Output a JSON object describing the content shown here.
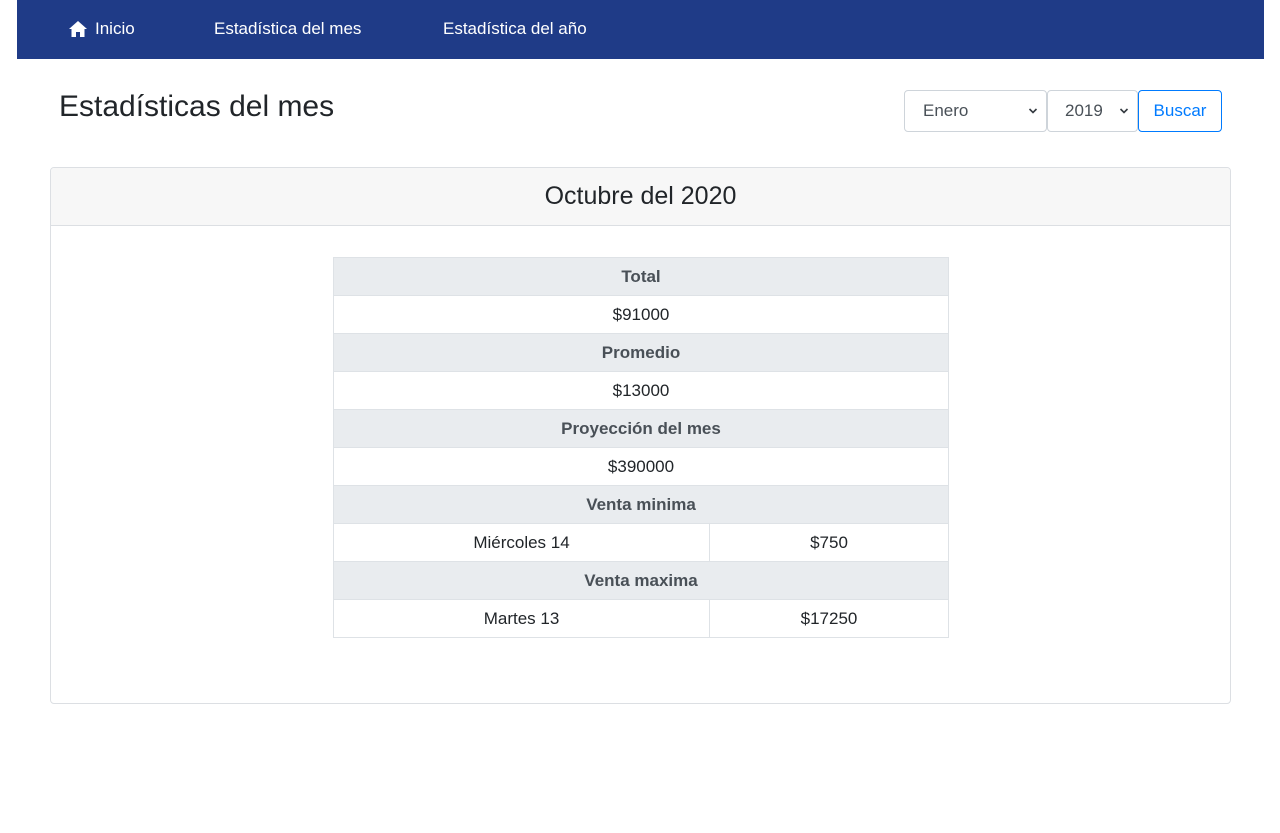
{
  "nav": {
    "home_label": "Inicio",
    "month_stats_label": "Estadística del mes",
    "year_stats_label": "Estadística del año",
    "home_icon": "home-icon"
  },
  "page": {
    "title": "Estadísticas del mes"
  },
  "filter": {
    "month_selected": "Enero",
    "year_selected": "2019",
    "search_label": "Buscar"
  },
  "card": {
    "title": "Octubre del 2020"
  },
  "stats": {
    "total_label": "Total",
    "total_value": "$91000",
    "average_label": "Promedio",
    "average_value": "$13000",
    "projection_label": "Proyección del mes",
    "projection_value": "$390000",
    "min_sale_label": "Venta minima",
    "min_sale_day": "Miércoles 14",
    "min_sale_value": "$750",
    "max_sale_label": "Venta maxima",
    "max_sale_day": "Martes 13",
    "max_sale_value": "$17250"
  },
  "colors": {
    "navbar": "#1f3b87",
    "accent": "#007bff",
    "table_header_bg": "#e9ecef"
  }
}
